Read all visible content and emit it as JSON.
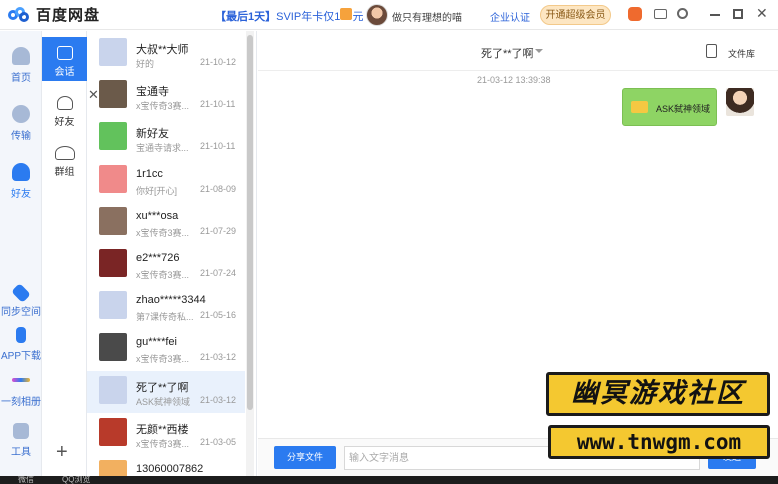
{
  "app": {
    "title": "百度网盘"
  },
  "header": {
    "promo_prefix": "【最后1天】",
    "promo_text": "SVIP年卡仅178元",
    "user_name": "做只有理想的喵",
    "enterprise_label": "企业认证",
    "vip_button": "开通超级会员"
  },
  "nav": {
    "home": "首页",
    "transfer": "传输",
    "friends": "好友",
    "sync": "同步空间",
    "app": "APP下载",
    "album": "一刻相册",
    "tools": "工具"
  },
  "subnav": {
    "chat": "会话",
    "friends": "好友",
    "groups": "群组",
    "add": "+"
  },
  "conversations": [
    {
      "name": "大叔**大师",
      "preview": "好的",
      "date": "21-10-12",
      "avatar_color": "#c9d4ec"
    },
    {
      "name": "宝通寺",
      "preview": "x宝传奇3赛...",
      "date": "21-10-11",
      "avatar_color": "#6b5a4a"
    },
    {
      "name": "新好友",
      "preview": "宝通寺请求...",
      "date": "21-10-11",
      "avatar_color": "#62c25c"
    },
    {
      "name": "1r1cc",
      "preview": "你好[开心]",
      "date": "21-08-09",
      "avatar_color": "#f08a8a"
    },
    {
      "name": "xu***osa",
      "preview": "x宝传奇3赛...",
      "date": "21-07-29",
      "avatar_color": "#8a7060"
    },
    {
      "name": "e2***726",
      "preview": "x宝传奇3赛...",
      "date": "21-07-24",
      "avatar_color": "#7a2525"
    },
    {
      "name": "zhao*****3344",
      "preview": "第7课传奇私...",
      "date": "21-05-16",
      "avatar_color": "#c9d4ec"
    },
    {
      "name": "gu****fei",
      "preview": "x宝传奇3赛...",
      "date": "21-03-12",
      "avatar_color": "#4a4a4a"
    },
    {
      "name": "死了**了啊",
      "preview": "ASK弑神领域",
      "date": "21-03-12",
      "avatar_color": "#c9d4ec"
    },
    {
      "name": "无颜**西楼",
      "preview": "x宝传奇3赛...",
      "date": "21-03-05",
      "avatar_color": "#b83a2a"
    },
    {
      "name": "13060007862",
      "preview": "",
      "date": "",
      "avatar_color": "#f2b060"
    }
  ],
  "chat": {
    "title": "死了**了啊",
    "library_label": "文件库",
    "timestamp": "21-03-12   13:39:38",
    "message": "ASK弑神领域",
    "share_button": "分享文件",
    "input_placeholder": "输入文字消息",
    "send_button": "发送"
  },
  "watermark": {
    "logo": "幽冥游戏社区",
    "url": "www.tnwgm.com"
  },
  "taskbar": {
    "item1": "微信",
    "item2": "QQ浏览"
  },
  "colors": {
    "accent": "#2b7bf0",
    "bubble": "#8ed464",
    "watermark_bg": "#f4c830"
  }
}
